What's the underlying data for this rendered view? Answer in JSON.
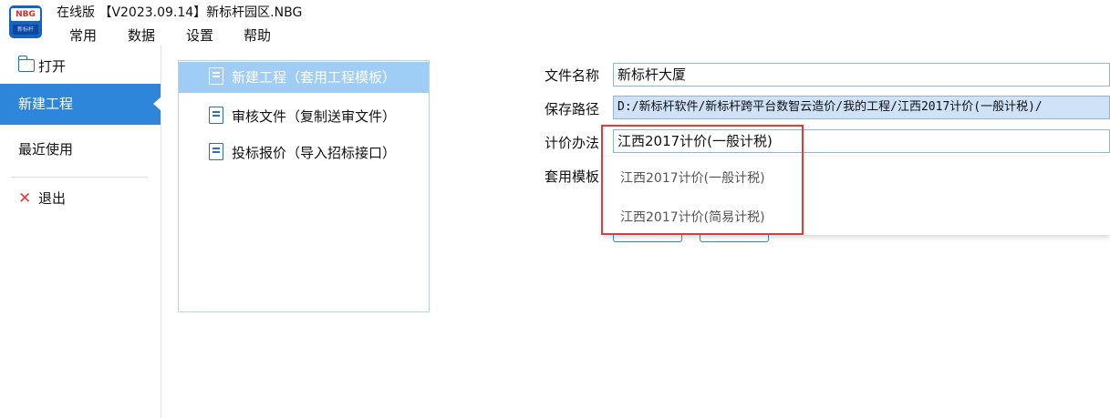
{
  "app": {
    "logo_text": "NBG",
    "logo_sub": "新标杆",
    "title": "在线版 【V2023.09.14】新标杆园区.NBG"
  },
  "menu": [
    "常用",
    "数据",
    "设置",
    "帮助"
  ],
  "nav": {
    "open": "打开",
    "new_project": "新建工程",
    "recent": "最近使用",
    "exit": "退出"
  },
  "templates": [
    "新建工程（套用工程模板）",
    "审核文件（复制送审文件）",
    "投标报价（导入招标接口）"
  ],
  "form": {
    "file_name_label": "文件名称",
    "file_name_value": "新标杆大厦",
    "save_path_label": "保存路径",
    "save_path_value": "D:/新标杆软件/新标杆跨平台数智云造价/我的工程/江西2017计价(一般计税)/",
    "method_label": "计价办法",
    "method_value": "江西2017计价(一般计税)",
    "template_label": "套用模板",
    "method_options": [
      "江西2017计价(一般计税)",
      "江西2017计价(简易计税)"
    ]
  },
  "colors": {
    "accent": "#2d86d9",
    "selected_template": "#9fcdf5",
    "highlight_box": "#e53935"
  }
}
